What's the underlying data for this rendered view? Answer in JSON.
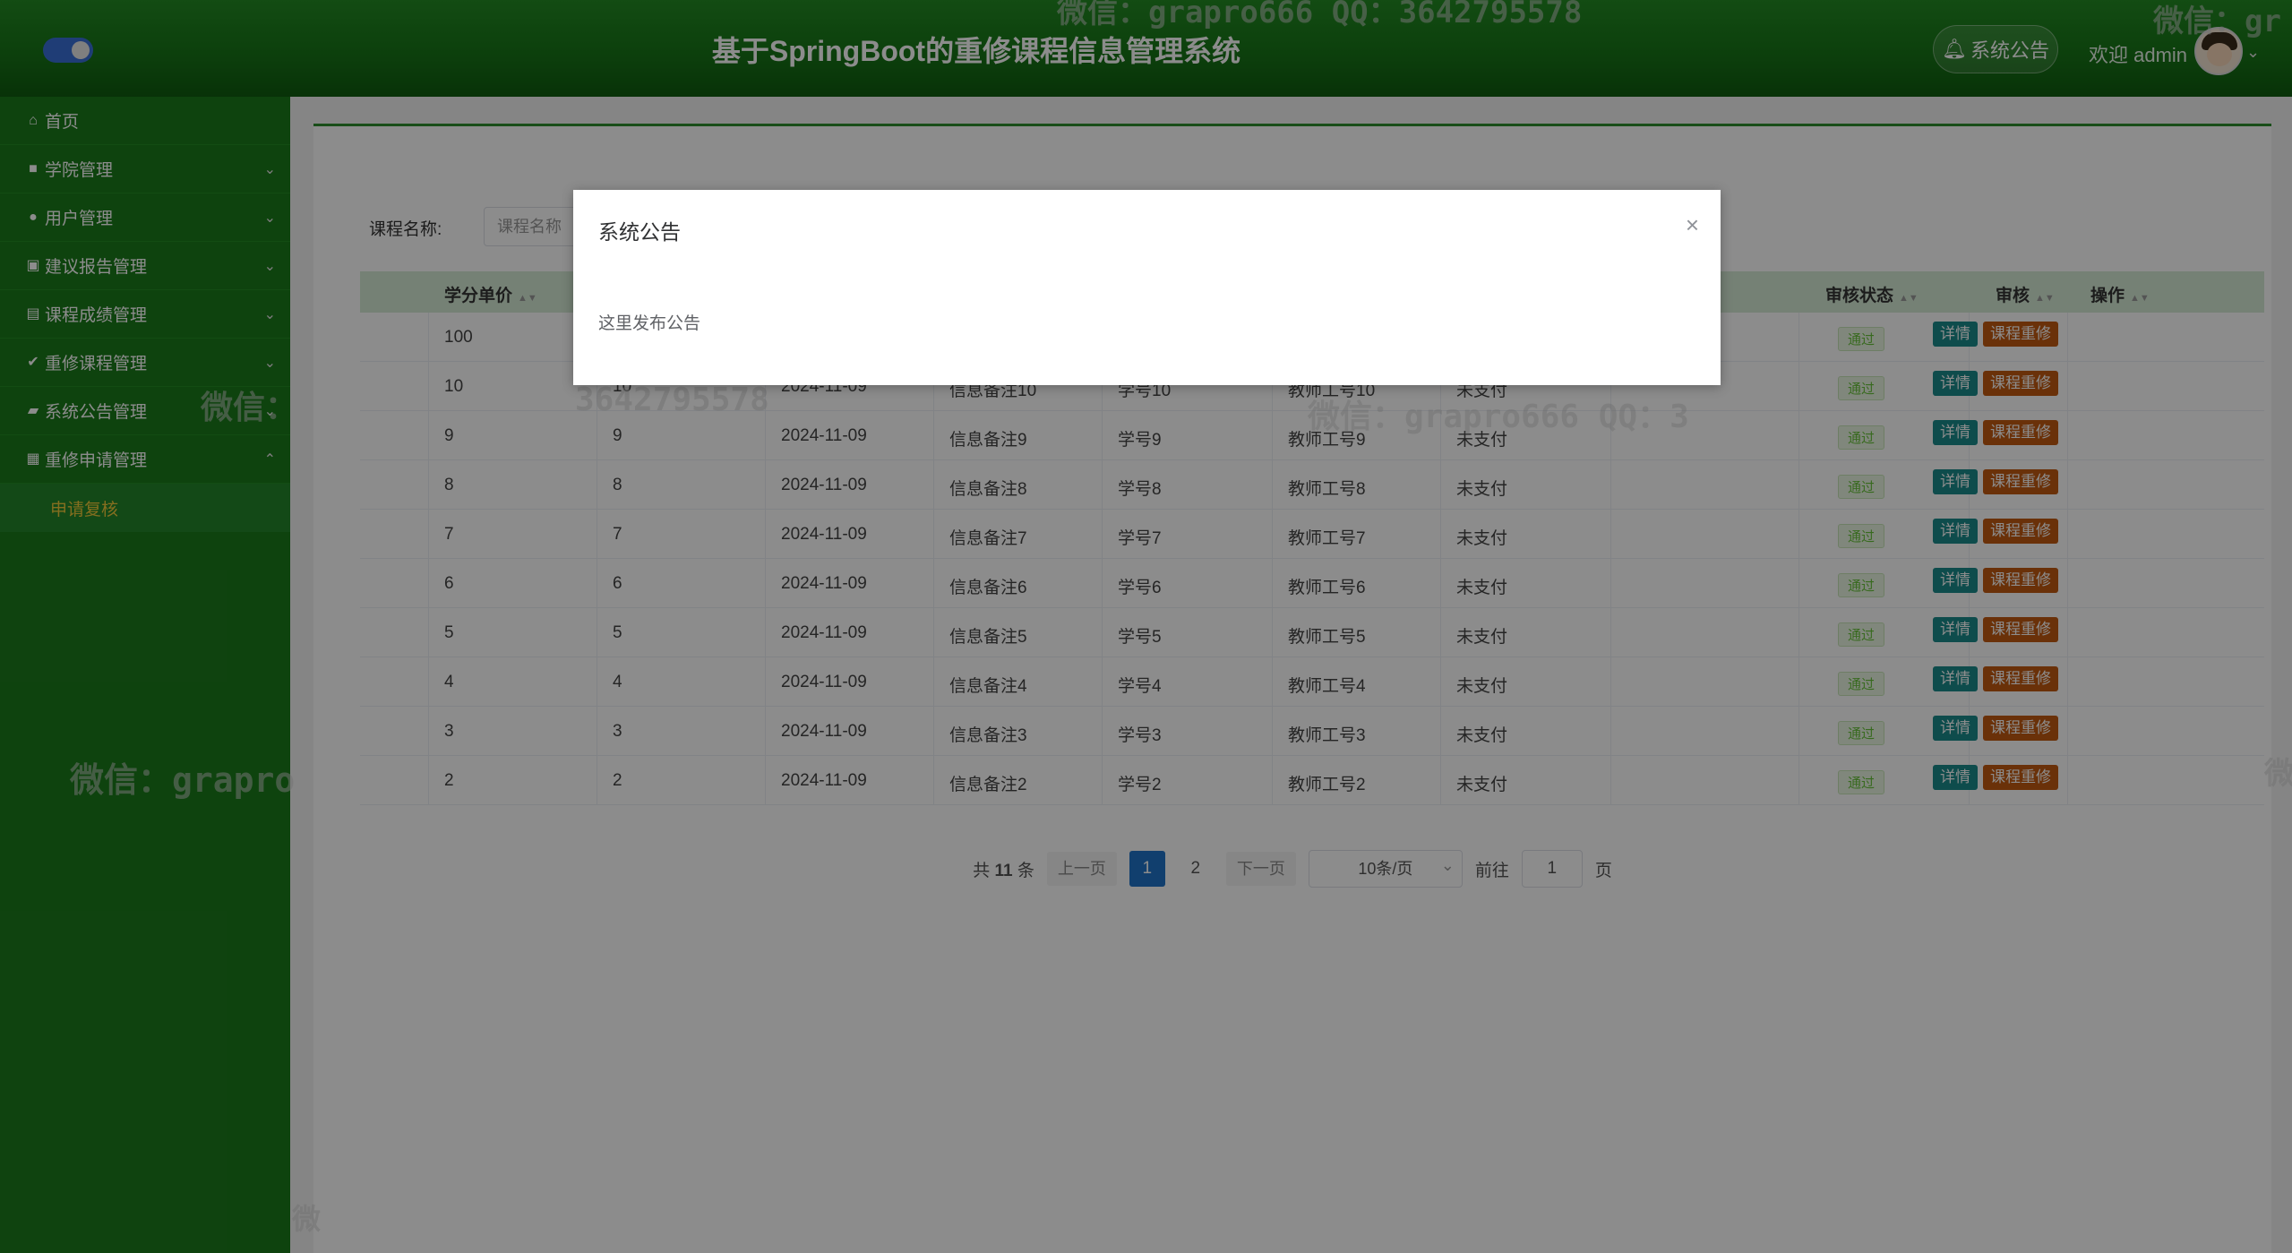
{
  "header": {
    "title": "基于SpringBoot的重修课程信息管理系统",
    "notice_button": "系统公告",
    "welcome": "欢迎 admin"
  },
  "sidebar": {
    "items": [
      {
        "label": "首页",
        "icon": "home-icon"
      },
      {
        "label": "学院管理",
        "icon": "book-icon"
      },
      {
        "label": "用户管理",
        "icon": "user-icon"
      },
      {
        "label": "建议报告管理",
        "icon": "report-icon"
      },
      {
        "label": "课程成绩管理",
        "icon": "chart-icon"
      },
      {
        "label": "重修课程管理",
        "icon": "check-icon"
      },
      {
        "label": "系统公告管理",
        "icon": "notice-icon"
      },
      {
        "label": "重修申请管理",
        "icon": "table-icon"
      }
    ],
    "subitem": "申请复核"
  },
  "search": {
    "label": "课程名称:",
    "placeholder": "课程名称"
  },
  "table": {
    "headers": [
      "学分单价",
      "审核状态",
      "审核",
      "操作"
    ],
    "rows": [
      {
        "c1": "100",
        "c2": "",
        "c3": "",
        "c4": "",
        "c5": "",
        "c6": "",
        "c7": ""
      },
      {
        "c1": "10",
        "c2": "10",
        "c3": "2024-11-09",
        "c4": "信息备注10",
        "c5": "学号10",
        "c6": "教师工号10",
        "c7": "未支付"
      },
      {
        "c1": "9",
        "c2": "9",
        "c3": "2024-11-09",
        "c4": "信息备注9",
        "c5": "学号9",
        "c6": "教师工号9",
        "c7": "未支付"
      },
      {
        "c1": "8",
        "c2": "8",
        "c3": "2024-11-09",
        "c4": "信息备注8",
        "c5": "学号8",
        "c6": "教师工号8",
        "c7": "未支付"
      },
      {
        "c1": "7",
        "c2": "7",
        "c3": "2024-11-09",
        "c4": "信息备注7",
        "c5": "学号7",
        "c6": "教师工号7",
        "c7": "未支付"
      },
      {
        "c1": "6",
        "c2": "6",
        "c3": "2024-11-09",
        "c4": "信息备注6",
        "c5": "学号6",
        "c6": "教师工号6",
        "c7": "未支付"
      },
      {
        "c1": "5",
        "c2": "5",
        "c3": "2024-11-09",
        "c4": "信息备注5",
        "c5": "学号5",
        "c6": "教师工号5",
        "c7": "未支付"
      },
      {
        "c1": "4",
        "c2": "4",
        "c3": "2024-11-09",
        "c4": "信息备注4",
        "c5": "学号4",
        "c6": "教师工号4",
        "c7": "未支付"
      },
      {
        "c1": "3",
        "c2": "3",
        "c3": "2024-11-09",
        "c4": "信息备注3",
        "c5": "学号3",
        "c6": "教师工号3",
        "c7": "未支付"
      },
      {
        "c1": "2",
        "c2": "2",
        "c3": "2024-11-09",
        "c4": "信息备注2",
        "c5": "学号2",
        "c6": "教师工号2",
        "c7": "未支付"
      }
    ],
    "status_label": "通过",
    "detail_label": "详情",
    "retake_label": "课程重修"
  },
  "pagination": {
    "total_prefix": "共",
    "total": "11",
    "total_suffix": "条",
    "prev": "上一页",
    "page1": "1",
    "page2": "2",
    "next": "下一页",
    "page_size": "10条/页",
    "goto_prefix": "前往",
    "goto_value": "1",
    "goto_suffix": "页"
  },
  "dialog": {
    "title": "系统公告",
    "close": "×",
    "body": "这里发布公告"
  },
  "watermarks": {
    "top_center": "微信：grapro666 QQ：3642795578",
    "top_right": "微信：gr",
    "mid_left": "微信：",
    "mid_qq": "3642795578",
    "mid_right": "微信：grapro666 QQ：3",
    "lower_left": "微信：grapro",
    "right_edge": "微",
    "bottom_left": "微"
  },
  "colors": {
    "header": "#177517",
    "sidebar": "#1b7a1b",
    "submenu_active": "#f0c93a",
    "detail_button": "#1a8a8a",
    "retake_button": "#c25a12",
    "page_active": "#1f74c9"
  }
}
